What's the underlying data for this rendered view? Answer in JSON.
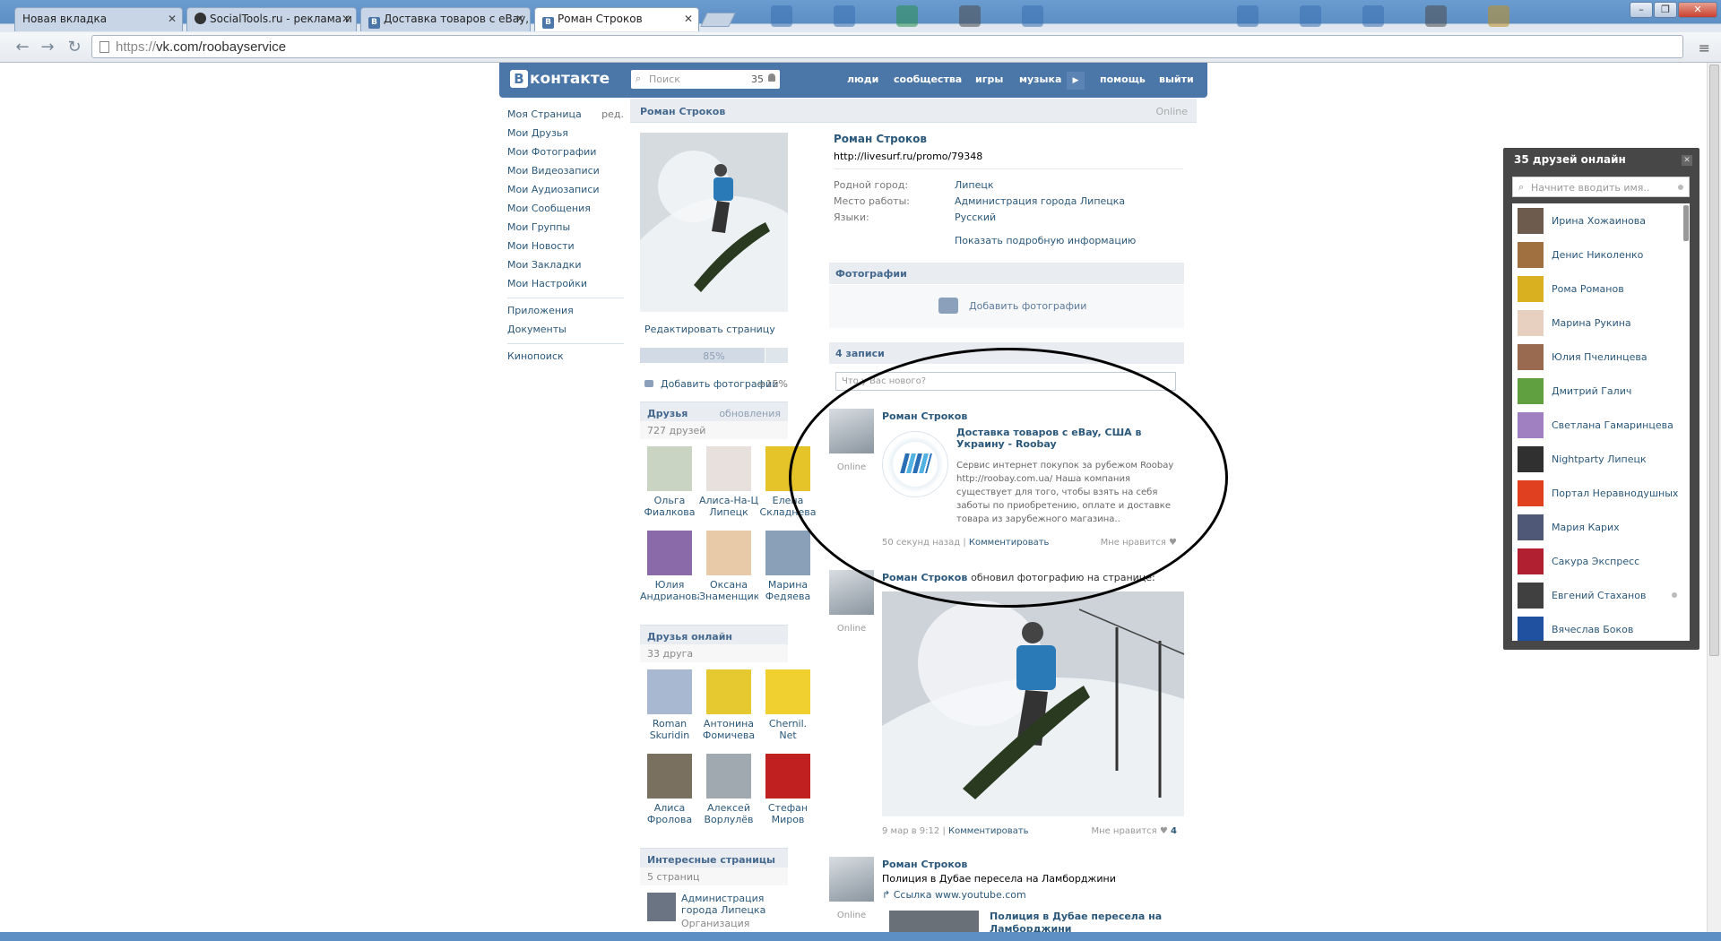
{
  "browser": {
    "tabs": [
      {
        "title": "Новая вкладка",
        "favicon": ""
      },
      {
        "title": "SocialTools.ru - реклама и",
        "favicon": "circle"
      },
      {
        "title": "Доставка товаров с eBay, С",
        "favicon": "B"
      },
      {
        "title": "Роман Строков",
        "favicon": "B"
      }
    ],
    "url_scheme": "https://",
    "url_rest": "vk.com/roobayservice",
    "menu_icon": "≡"
  },
  "vk": {
    "logo_text": "контакте",
    "logo_letter": "В",
    "search_placeholder": "Поиск",
    "search_count": "35",
    "nav": [
      "люди",
      "сообщества",
      "игры",
      "музыка",
      "помощь",
      "выйти"
    ],
    "left_menu": [
      "Моя Страница",
      "Мои Друзья",
      "Мои Фотографии",
      "Мои Видеозаписи",
      "Мои Аудиозаписи",
      "Мои Сообщения",
      "Мои Группы",
      "Мои Новости",
      "Мои Закладки",
      "Мои Настройки"
    ],
    "left_menu_edit": "ред.",
    "left_menu2": [
      "Приложения",
      "Документы"
    ],
    "left_menu3": [
      "Кинопоиск"
    ]
  },
  "profile": {
    "name": "Роман Строков",
    "online": "Online",
    "status": "http://livesurf.ru/promo/79348",
    "edit_page": "Редактировать страницу",
    "progress_label": "85%",
    "progress": 0.85,
    "add_photos": "Добавить фотографии",
    "add_photos_bonus": "+15%",
    "info": [
      {
        "label": "Родной город:",
        "value": "Липецк"
      },
      {
        "label": "Место работы:",
        "value": "Администрация города Липецка"
      },
      {
        "label": "Языки:",
        "value": "Русский"
      }
    ],
    "show_more": "Показать подробную информацию",
    "photos_header": "Фотографии",
    "photos_add": "Добавить фотографии",
    "wall_header": "4 записи",
    "compose_placeholder": "Что у Вас нового?"
  },
  "friends": {
    "header": "Друзья",
    "updates": "обновления",
    "count": "727 друзей",
    "items": [
      {
        "first": "Ольга",
        "last": "Фиалкова",
        "color": "#c9d4c2"
      },
      {
        "first": "Алиса-На-Цве",
        "last": "Липецк",
        "color": "#e8e0dc"
      },
      {
        "first": "Елена",
        "last": "Складнева",
        "color": "#e5c42a"
      },
      {
        "first": "Юлия",
        "last": "Андрианова",
        "color": "#8a6aa8"
      },
      {
        "first": "Оксана",
        "last": "Знаменщикова",
        "color": "#e8c9a8"
      },
      {
        "first": "Марина",
        "last": "Федяева",
        "color": "#8aa0b8"
      }
    ]
  },
  "friends_online": {
    "header": "Друзья онлайн",
    "count": "33 друга",
    "items": [
      {
        "first": "Roman",
        "last": "Skuridin",
        "color": "#a8b8d0"
      },
      {
        "first": "Антонина",
        "last": "Фомичева",
        "color": "#e6c830"
      },
      {
        "first": "Chernil.",
        "last": "Net",
        "color": "#f0d030"
      },
      {
        "first": "Алиса",
        "last": "Фролова",
        "color": "#7a7060"
      },
      {
        "first": "Алексей",
        "last": "Ворлулёв",
        "color": "#a0a8b0"
      },
      {
        "first": "Стефан",
        "last": "Миров",
        "color": "#c02020"
      }
    ]
  },
  "interesting": {
    "header": "Интересные страницы",
    "count": "5 страниц",
    "item_title": "Администрация города Липецка",
    "item_sub": "Организация"
  },
  "posts": [
    {
      "author": "Роман Строков",
      "online": "Online",
      "link_title": "Доставка товаров с eBay, США в Украину - Roobay",
      "link_desc": "Сервис интернет покупок за рубежом Roobay http://roobay.com.ua/ Наша компания существует для того, чтобы взять на себя заботы по приобретению, оплате и доставке товара из зарубежного магазина..",
      "time": "50 секунд назад",
      "comment": "Комментировать",
      "like": "Мне нравится",
      "like_count": ""
    },
    {
      "author": "Роман Строков",
      "action": "обновил фотографию на странице:",
      "online": "Online",
      "time": "9 мар в 9:12",
      "comment": "Комментировать",
      "like": "Мне нравится",
      "like_count": "4"
    },
    {
      "author": "Роман Строков",
      "online": "Online",
      "text": "Полиция в Дубае пересела на Ламборджини",
      "link": "Ссылка www.youtube.com",
      "link_title": "Полиция в Дубае пересела на Ламборджини"
    }
  ],
  "online_panel": {
    "header": "35 друзей онлайн",
    "close": "✕",
    "search_placeholder": "Начните вводить имя..",
    "friends": [
      {
        "name": "Ирина Хожаинова",
        "color": "#6d5c4e"
      },
      {
        "name": "Денис Николенко",
        "color": "#a07040"
      },
      {
        "name": "Рома Романов",
        "color": "#d8b020"
      },
      {
        "name": "Марина Рукина",
        "color": "#e8d0c0"
      },
      {
        "name": "Юлия Пчелинцева",
        "color": "#9a6a50"
      },
      {
        "name": "Дмитрий Галич",
        "color": "#60a040"
      },
      {
        "name": "Светлана Гамаринцева",
        "color": "#a080c0"
      },
      {
        "name": "Nightparty Липецк",
        "color": "#303030"
      },
      {
        "name": "Портал Неравнодушных",
        "color": "#e04020"
      },
      {
        "name": "Мария Карих",
        "color": "#505878"
      },
      {
        "name": "Сакура Экспресс",
        "color": "#b02030"
      },
      {
        "name": "Евгений Стаханов",
        "color": "#404040"
      },
      {
        "name": "Вячеслав Боков",
        "color": "#2050a0"
      }
    ]
  }
}
